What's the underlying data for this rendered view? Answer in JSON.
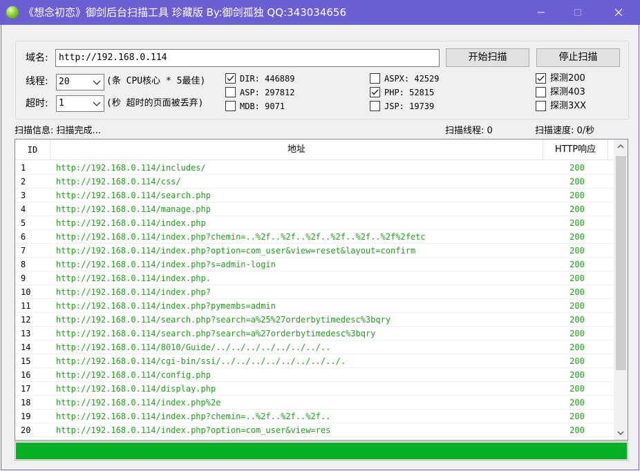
{
  "window": {
    "title": "《想念初恋》御剑后台扫描工具 珍藏版 By:御剑孤独 QQ:343034656",
    "controls": {
      "minimize": "minimize-icon",
      "maximize": "maximize-icon",
      "close": "close-icon"
    }
  },
  "form": {
    "domain_label": "域名:",
    "domain_value": "http://192.168.0.114",
    "threads_label": "线程:",
    "threads_value": "20",
    "threads_hint": "(条 CPU核心 * 5最佳)",
    "timeout_label": "超时:",
    "timeout_value": "1",
    "timeout_hint": "(秒 超时的页面被丢弃)",
    "start_button": "开始扫描",
    "stop_button": "停止扫描"
  },
  "dicts": [
    {
      "label": "DIR: 446889",
      "checked": true
    },
    {
      "label": "ASP: 297812",
      "checked": false
    },
    {
      "label": "MDB: 9071",
      "checked": false
    },
    {
      "label": "ASPX: 42529",
      "checked": false
    },
    {
      "label": "PHP: 52815",
      "checked": true
    },
    {
      "label": "JSP: 19739",
      "checked": false
    }
  ],
  "probes": [
    {
      "label": "探测200",
      "checked": true
    },
    {
      "label": "探测403",
      "checked": false
    },
    {
      "label": "探测3XX",
      "checked": false
    }
  ],
  "status": {
    "info": "扫描信息: 扫描完成...",
    "threads": "扫描线程: 0",
    "speed": "扫描速度: 0/秒"
  },
  "table": {
    "headers": {
      "id": "ID",
      "url": "地址",
      "code": "HTTP响应"
    },
    "rows": [
      {
        "id": "1",
        "url": "http://192.168.0.114/includes/",
        "code": "200"
      },
      {
        "id": "2",
        "url": "http://192.168.0.114/css/",
        "code": "200"
      },
      {
        "id": "3",
        "url": "http://192.168.0.114/search.php",
        "code": "200"
      },
      {
        "id": "4",
        "url": "http://192.168.0.114/manage.php",
        "code": "200"
      },
      {
        "id": "5",
        "url": "http://192.168.0.114/index.php",
        "code": "200"
      },
      {
        "id": "6",
        "url": "http://192.168.0.114/index.php?chemin=..%2f..%2f..%2f..%2f..%2f..%2f%2fetc",
        "code": "200"
      },
      {
        "id": "7",
        "url": "http://192.168.0.114/index.php?option=com_user&view=reset&layout=confirm",
        "code": "200"
      },
      {
        "id": "8",
        "url": "http://192.168.0.114/index.php?s=admin-login",
        "code": "200"
      },
      {
        "id": "9",
        "url": "http://192.168.0.114/index.php.",
        "code": "200"
      },
      {
        "id": "10",
        "url": "http://192.168.0.114/index.php?",
        "code": "200"
      },
      {
        "id": "11",
        "url": "http://192.168.0.114/index.php?pymembs=admin",
        "code": "200"
      },
      {
        "id": "12",
        "url": "http://192.168.0.114/search.php?search=a%25%27orderbytimedesc%3bqry",
        "code": "200"
      },
      {
        "id": "13",
        "url": "http://192.168.0.114/search.php?search=a%27orderbytimedesc%3bqry",
        "code": "200"
      },
      {
        "id": "14",
        "url": "http://192.168.0.114/8010/Guide/../../../../../../../..",
        "code": "200"
      },
      {
        "id": "15",
        "url": "http://192.168.0.114/cgi-bin/ssi/../../../../../../../../.",
        "code": "200"
      },
      {
        "id": "16",
        "url": "http://192.168.0.114/config.php",
        "code": "200"
      },
      {
        "id": "17",
        "url": "http://192.168.0.114/display.php",
        "code": "200"
      },
      {
        "id": "18",
        "url": "http://192.168.0.114/index.php%2e",
        "code": "200"
      },
      {
        "id": "19",
        "url": "http://192.168.0.114/index.php?chemin=..%2f..%2f..%2f..",
        "code": "200"
      },
      {
        "id": "20",
        "url": "http://192.168.0.114/index.php?option=com_user&view=res",
        "code": "200"
      }
    ]
  },
  "progress": {
    "value": 1.0
  },
  "colors": {
    "titlebar": "#6b5fd3",
    "result_text": "#22a01e",
    "progress_fill": "#06b025"
  }
}
